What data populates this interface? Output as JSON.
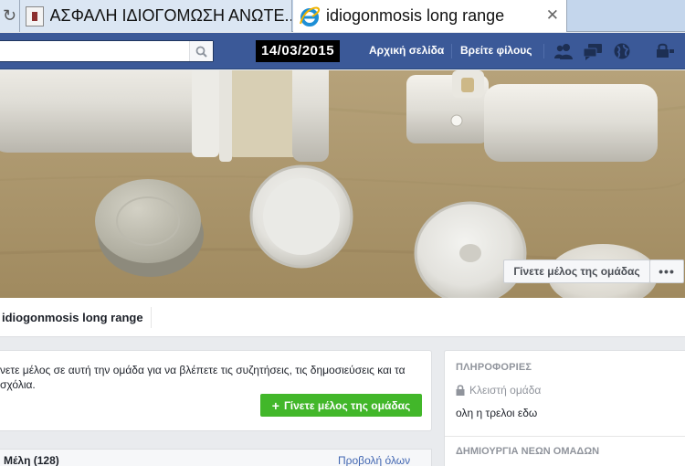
{
  "browser": {
    "tabs": [
      {
        "title": "ΑΣΦΑΛΗ ΙΔΙΟΓΟΜΩΣΗ ΑΝΩΤΕ...",
        "active": false,
        "icon": "document-icon"
      },
      {
        "title": "idiogonmosis long range",
        "active": true,
        "icon": "ie-icon"
      }
    ],
    "close_glyph": "✕",
    "reload_glyph": "↻"
  },
  "topbar": {
    "search_placeholder": "",
    "date": "14/03/2015",
    "nav": {
      "home": "Αρχική σελίδα",
      "find_friends": "Βρείτε φίλους"
    },
    "icons": [
      "friend-requests-icon",
      "messages-icon",
      "notifications-globe-icon",
      "privacy-lock-icon"
    ],
    "color": "#3b5998"
  },
  "cover": {
    "join_label": "Γίνετε μέλος της ομάδας",
    "more_label": "•••"
  },
  "group": {
    "name": "idiogonmosis long range"
  },
  "join_panel": {
    "text": "νετε μέλος σε αυτή την ομάδα για να βλέπετε τις συζητήσεις, τις δημοσιεύσεις και τα σχόλια.",
    "button_label": "Γίνετε μέλος της ομάδας",
    "button_plus": "+",
    "button_color": "#42b72a"
  },
  "members": {
    "title": "Μέλη (128)",
    "view_all": "Προβολή όλων"
  },
  "info": {
    "heading": "ΠΛΗΡΟΦΟΡΙΕΣ",
    "privacy": "Κλειστή ομάδα",
    "description": "ολη η τρελοι εδω",
    "create_heading": "ΔΗΜΙΟΥΡΓΙΑ ΝΕΩΝ ΟΜΑΔΩΝ"
  }
}
